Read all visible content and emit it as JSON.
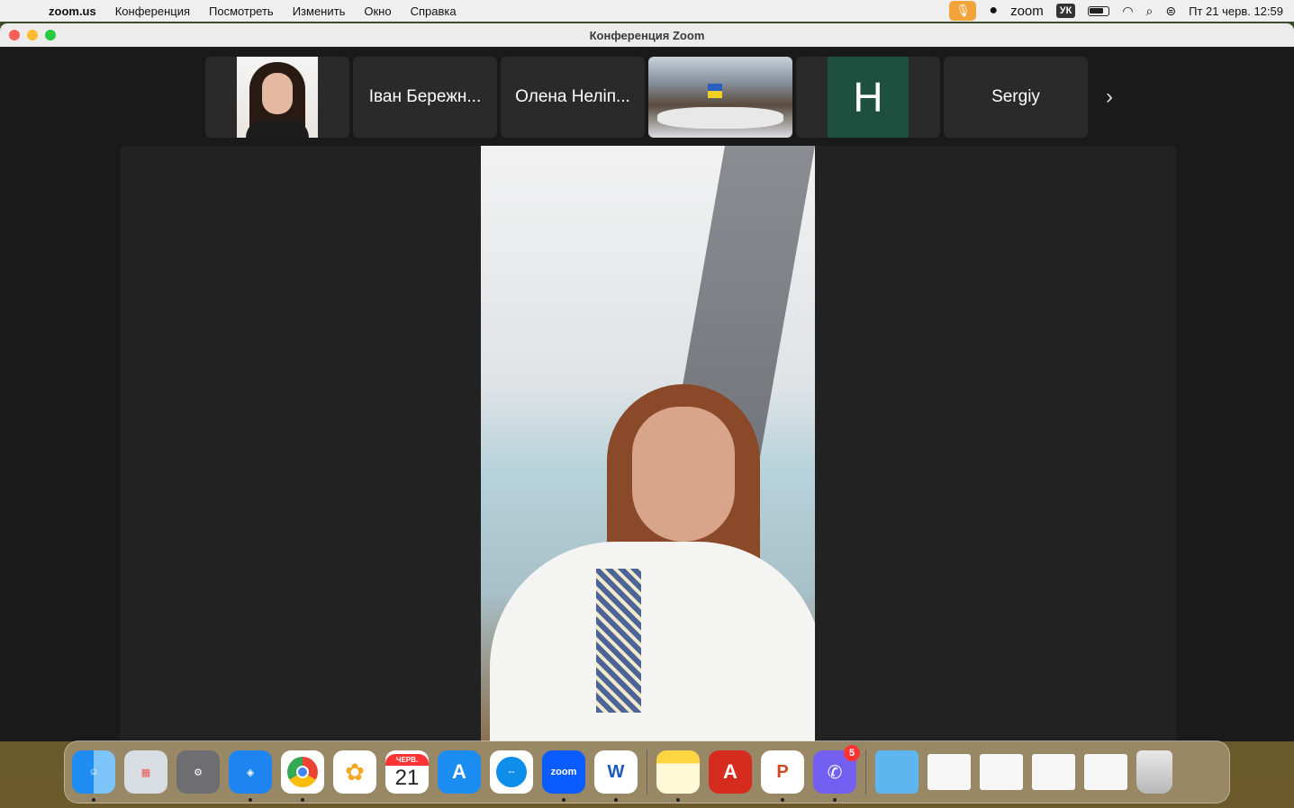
{
  "menubar": {
    "app_name": "zoom.us",
    "menus": [
      "Конференция",
      "Посмотреть",
      "Изменить",
      "Окно",
      "Справка"
    ],
    "zoom_label": "zoom",
    "input_source": "УК",
    "datetime": "Пт 21 черв.  12:59"
  },
  "window": {
    "title": "Конференция Zoom"
  },
  "participants": {
    "tile_2_name": "Іван Бережн...",
    "tile_3_name": "Олена Неліп...",
    "tile_5_initial": "H",
    "tile_6_name": "Sergiy"
  },
  "dock": {
    "calendar_month": "ЧЕРВ.",
    "calendar_day": "21",
    "zoom_label": "zoom",
    "word_label": "W",
    "acrobat_label": "A",
    "powerpoint_label": "P",
    "viber_badge": "5"
  }
}
